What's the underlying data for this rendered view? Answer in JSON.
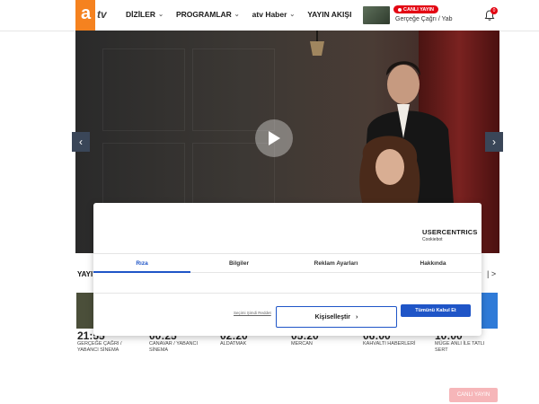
{
  "header": {
    "nav": [
      {
        "label": "DİZİLER"
      },
      {
        "label": "PROGRAMLAR"
      },
      {
        "label": "atv Haber"
      },
      {
        "label": "YAYIN AKIŞI"
      }
    ],
    "live_badge": "CANLI YAYIN",
    "live_program": "Gerçeğe Çağrı / Yab",
    "notification_count": "0"
  },
  "hero": {
    "prev_label": "‹",
    "next_label": "›"
  },
  "schedule": {
    "title": "YAYI",
    "more_arrow": "| >",
    "items": [
      {
        "time": "21:55",
        "name": "GERÇEĞE ÇAĞRI / YABANCI SİNEMA"
      },
      {
        "time": "00:25",
        "name": "CANAVAR / YABANCI SİNEMA"
      },
      {
        "time": "02:20",
        "name": "ALDATMAK"
      },
      {
        "time": "05:20",
        "name": "MERCAN"
      },
      {
        "time": "06:00",
        "name": "KAHVALTI HABERLERİ"
      },
      {
        "time": "10:00",
        "name": "MÜGE ANLI İLE TATLI SERT"
      }
    ]
  },
  "consent": {
    "brand": "USERCENTRICS",
    "brand_sub": "Cookiebot",
    "tabs": [
      {
        "label": "Rıza",
        "active": true
      },
      {
        "label": "Bilgiler",
        "active": false
      },
      {
        "label": "Reklam Ayarları",
        "active": false
      },
      {
        "label": "Hakkında",
        "active": false
      }
    ],
    "deny_label": "Seçimi Şimdi Reddet",
    "customize_label": "Kişiselleştir",
    "accept_label": "Tümünü Kabul Et"
  },
  "footer": {
    "blog_button": "CANLI YAYIN"
  },
  "colors": {
    "brand_orange": "#f5821f",
    "live_red": "#e30613",
    "accent_blue": "#1f55c7"
  }
}
